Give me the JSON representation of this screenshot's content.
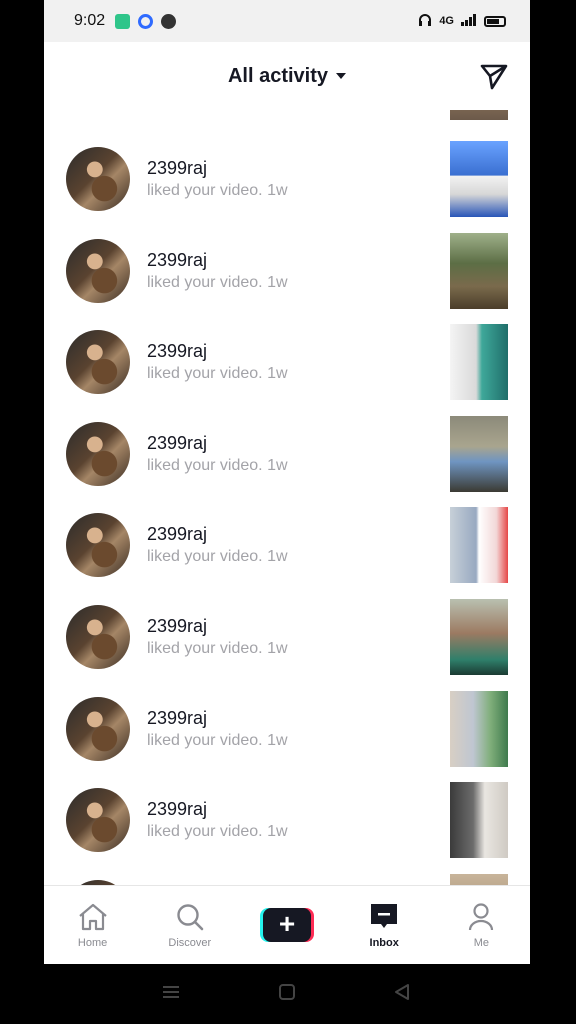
{
  "status_bar": {
    "time": "9:02",
    "signal": "4G"
  },
  "header": {
    "title": "All activity"
  },
  "notifications": [
    {
      "username": "2399raj",
      "action": "liked your video.",
      "time": "1w",
      "thumb": "boy-blue-shirt"
    },
    {
      "username": "2399raj",
      "action": "liked your video.",
      "time": "1w",
      "thumb": "field"
    },
    {
      "username": "2399raj",
      "action": "liked your video.",
      "time": "1w",
      "thumb": "two-kids"
    },
    {
      "username": "2399raj",
      "action": "liked your video.",
      "time": "1w",
      "thumb": "boy-sitting"
    },
    {
      "username": "2399raj",
      "action": "liked your video.",
      "time": "1w",
      "thumb": "split-kids"
    },
    {
      "username": "2399raj",
      "action": "liked your video.",
      "time": "1w",
      "thumb": "smiling-kid"
    },
    {
      "username": "2399raj",
      "action": "liked your video.",
      "time": "1w",
      "thumb": "kids-garden"
    },
    {
      "username": "2399raj",
      "action": "liked your video.",
      "time": "1w",
      "thumb": "white-shirt"
    }
  ],
  "bottom_nav": {
    "home": "Home",
    "discover": "Discover",
    "inbox": "Inbox",
    "me": "Me"
  },
  "colors": {
    "accent_cyan": "#25f4ee",
    "accent_red": "#fe2c55",
    "text_primary": "#161823",
    "text_secondary": "#a3a3a8"
  }
}
